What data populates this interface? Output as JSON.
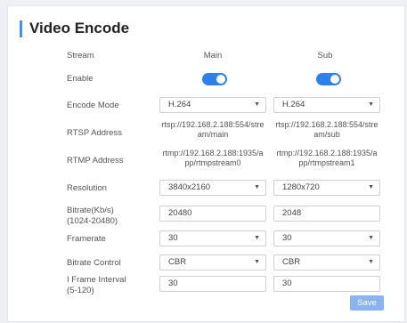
{
  "page": {
    "title": "Video Encode",
    "accent": "#4a90e2"
  },
  "columns": {
    "stream_label": "Stream",
    "main": "Main",
    "sub": "Sub"
  },
  "labels": {
    "enable": "Enable",
    "encode_mode": "Encode Mode",
    "rtsp": "RTSP Address",
    "rtmp": "RTMP Address",
    "resolution": "Resolution",
    "bitrate": "Bitrate(Kb/s)",
    "bitrate_range": "(1024-20480)",
    "framerate": "Framerate",
    "bitrate_control": "Bitrate Control",
    "iframe": "I Frame Interval",
    "iframe_range": "(5-120)"
  },
  "main": {
    "enabled": true,
    "encode_mode": "H.264",
    "rtsp_l1": "rtsp://192.168.2.188:554/stre",
    "rtsp_l2": "am/main",
    "rtmp_l1": "rtmp://192.168.2.188:1935/a",
    "rtmp_l2": "pp/rtmpstream0",
    "resolution": "3840x2160",
    "bitrate": "20480",
    "framerate": "30",
    "bitrate_control": "CBR",
    "iframe": "30"
  },
  "sub": {
    "enabled": true,
    "encode_mode": "H.264",
    "rtsp_l1": "rtsp://192.168.2.188:554/stre",
    "rtsp_l2": "am/sub",
    "rtmp_l1": "rtmp://192.168.2.188:1935/a",
    "rtmp_l2": "pp/rtmpstream1",
    "resolution": "1280x720",
    "bitrate": "2048",
    "framerate": "30",
    "bitrate_control": "CBR",
    "iframe": "30"
  },
  "actions": {
    "save": "Save"
  },
  "icons": {
    "dropdown": "chevron-down-icon",
    "dropdown_glyph": "▼"
  }
}
